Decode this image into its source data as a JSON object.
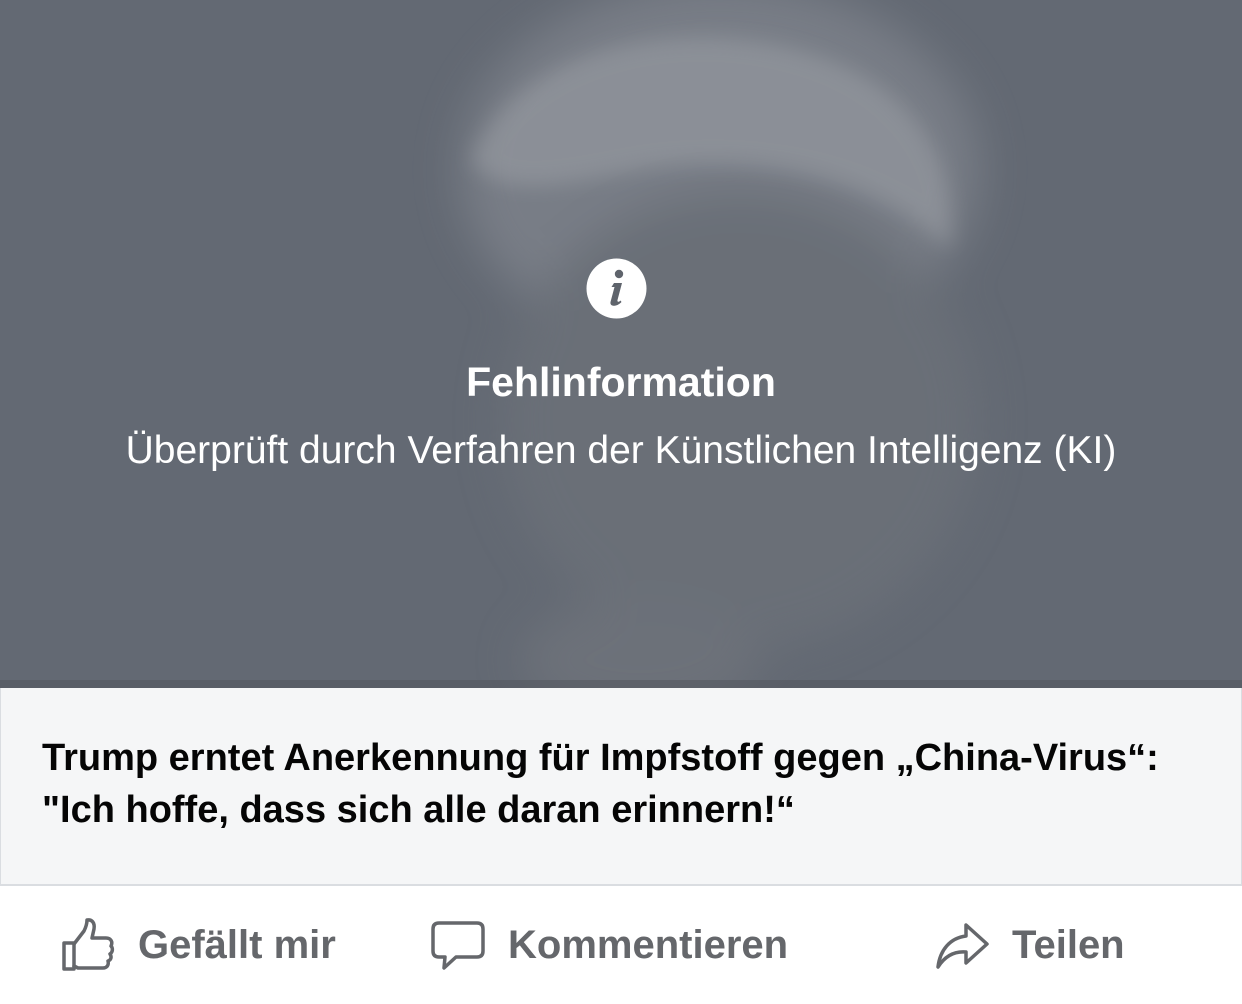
{
  "overlay": {
    "icon": "info-icon",
    "title": "Fehlinformation",
    "subtitle": "Überprüft durch Verfahren der Künstlichen Intelligenz (KI)"
  },
  "link_card": {
    "headline": "Trump erntet Anerkennung für Impfstoff gegen „China-Virus“: \"Ich hoffe, dass sich alle daran erinnern!“"
  },
  "actions": [
    {
      "icon": "thumbs-up-icon",
      "label": "Gefällt mir"
    },
    {
      "icon": "comment-icon",
      "label": "Kommentieren"
    },
    {
      "icon": "share-icon",
      "label": "Teilen"
    }
  ],
  "colors": {
    "overlay_bg": "#646a73",
    "card_bg": "#f5f6f7",
    "action_text": "#65676b",
    "headline_text": "#050505"
  }
}
